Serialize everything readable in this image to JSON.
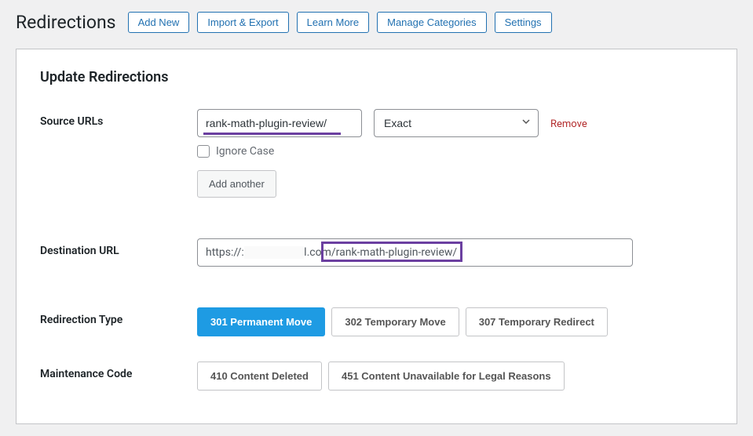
{
  "page_title": "Redirections",
  "header_buttons": {
    "add_new": "Add New",
    "import_export": "Import & Export",
    "learn_more": "Learn More",
    "manage_categories": "Manage Categories",
    "settings": "Settings"
  },
  "panel": {
    "title": "Update Redirections"
  },
  "fields": {
    "source_urls_label": "Source URLs",
    "source_value": "rank-math-plugin-review/",
    "match_type": "Exact",
    "remove_label": "Remove",
    "ignore_case_label": "Ignore Case",
    "add_another_label": "Add another",
    "destination_url_label": "Destination URL",
    "destination_prefix": "https://:",
    "destination_mid": "l.com",
    "destination_path": "/rank-math-plugin-review/",
    "redirection_type_label": "Redirection Type",
    "maintenance_code_label": "Maintenance Code"
  },
  "redirection_types": {
    "r301": "301 Permanent Move",
    "r302": "302 Temporary Move",
    "r307": "307 Temporary Redirect"
  },
  "maintenance_codes": {
    "c410": "410 Content Deleted",
    "c451": "451 Content Unavailable for Legal Reasons"
  }
}
